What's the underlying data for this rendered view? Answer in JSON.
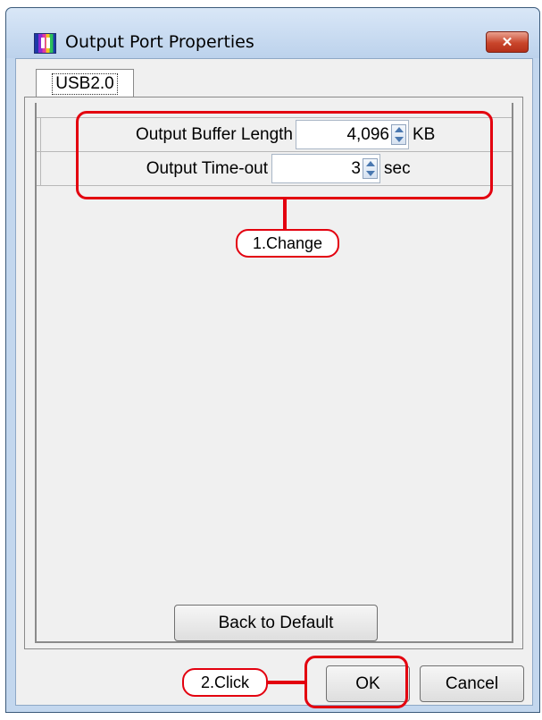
{
  "window": {
    "title": "Output Port Properties",
    "close_glyph": "✕"
  },
  "tab": {
    "label": "USB2.0"
  },
  "properties": [
    {
      "label": "Output Buffer Length",
      "value": "4,096",
      "unit": "KB"
    },
    {
      "label": "Output Time-out",
      "value": "3",
      "unit": "sec"
    }
  ],
  "buttons": {
    "default_label": "Back to Default",
    "ok_label": "OK",
    "cancel_label": "Cancel"
  },
  "annotations": {
    "change": "1.Change",
    "click": "2.Click"
  },
  "colors": {
    "annotation": "#e3000f",
    "title_bar": "#c3d7ee",
    "close_button": "#c9452b"
  },
  "icons": {
    "app": "app-icon",
    "close": "close-icon",
    "spin": "spin-arrows-icon"
  }
}
